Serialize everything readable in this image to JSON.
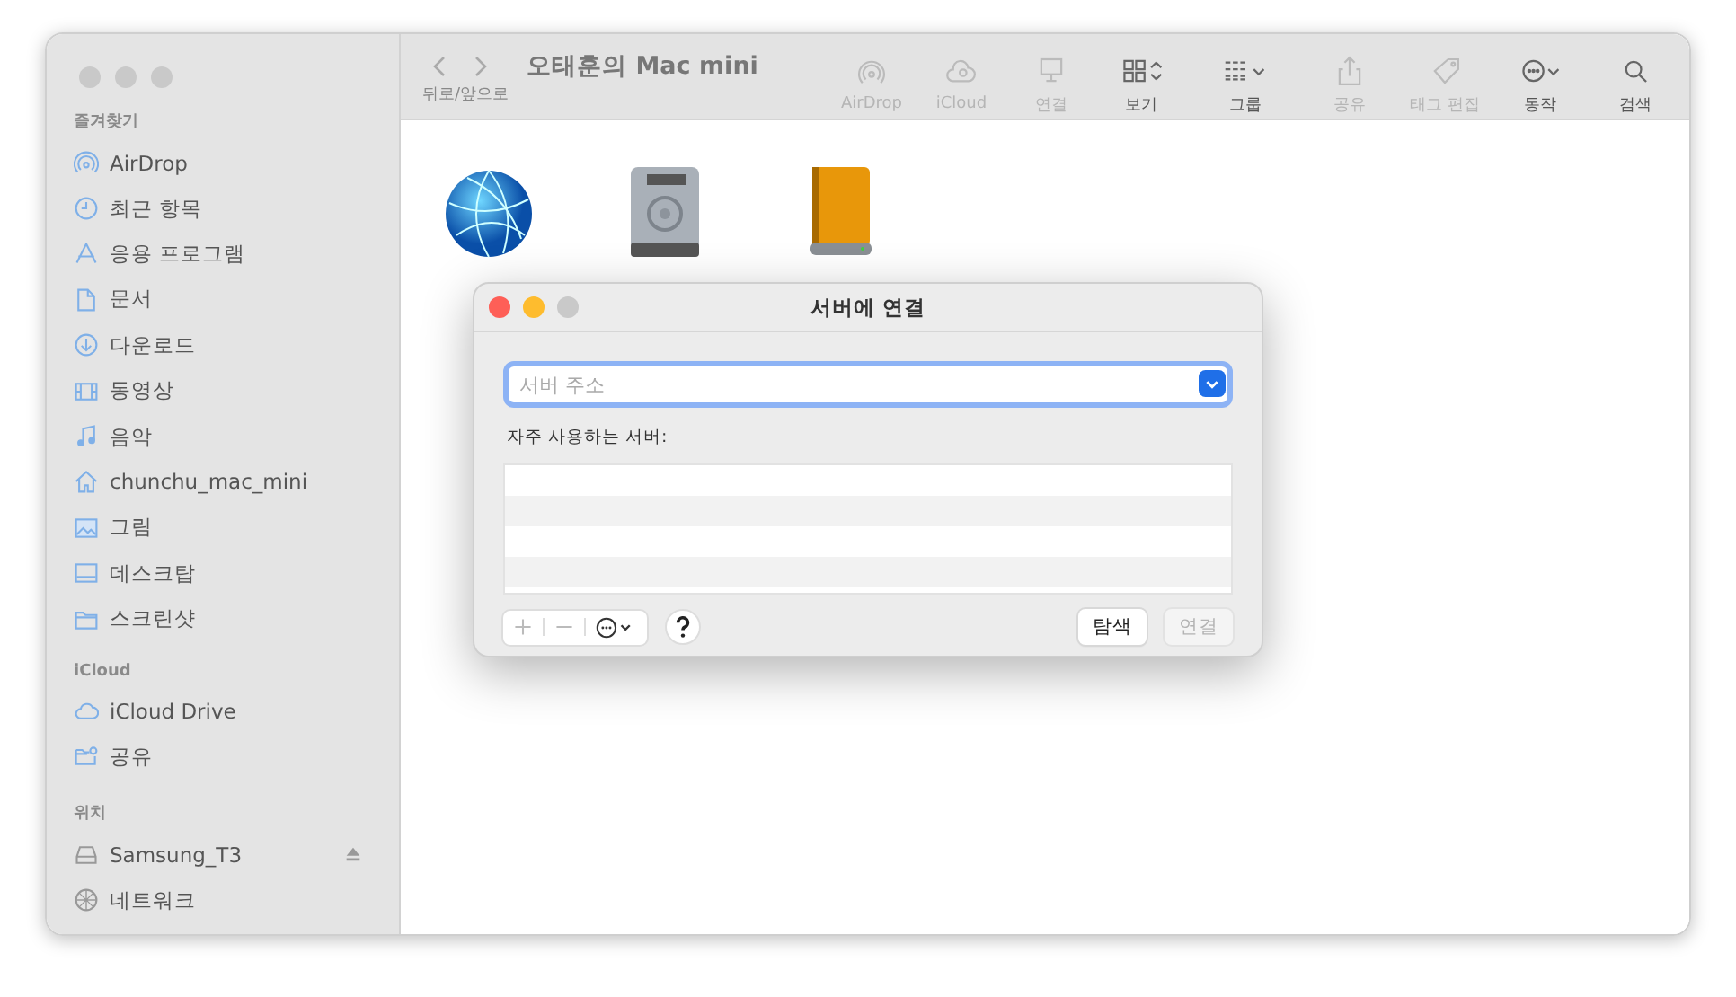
{
  "window": {
    "title": "오태훈의 Mac mini",
    "nav_label": "뒤로/앞으로"
  },
  "toolbar": [
    {
      "label": "AirDrop",
      "disabled": true
    },
    {
      "label": "iCloud",
      "disabled": true
    },
    {
      "label": "연결",
      "disabled": true
    },
    {
      "label": "보기",
      "disabled": false
    },
    {
      "label": "그룹",
      "disabled": false
    },
    {
      "label": "공유",
      "disabled": true
    },
    {
      "label": "태그 편집",
      "disabled": true
    },
    {
      "label": "동작",
      "disabled": false
    },
    {
      "label": "검색",
      "disabled": false
    }
  ],
  "sidebar": {
    "sections": [
      {
        "title": "즐겨찾기",
        "items": [
          {
            "label": "AirDrop"
          },
          {
            "label": "최근 항목"
          },
          {
            "label": "응용 프로그램"
          },
          {
            "label": "문서"
          },
          {
            "label": "다운로드"
          },
          {
            "label": "동영상"
          },
          {
            "label": "음악"
          },
          {
            "label": "chunchu_mac_mini"
          },
          {
            "label": "그림"
          },
          {
            "label": "데스크탑"
          },
          {
            "label": "스크린샷"
          }
        ]
      },
      {
        "title": "iCloud",
        "items": [
          {
            "label": "iCloud Drive"
          },
          {
            "label": "공유"
          }
        ]
      },
      {
        "title": "위치",
        "items": [
          {
            "label": "Samsung_T3",
            "eject": true
          },
          {
            "label": "네트워크",
            "eject": false
          }
        ]
      }
    ]
  },
  "files": [
    {
      "kind": "network"
    },
    {
      "kind": "disk"
    },
    {
      "kind": "external"
    }
  ],
  "dialog": {
    "title": "서버에 연결",
    "address": {
      "placeholder": "서버 주소"
    },
    "favorites_label": "자주 사용하는 서버:",
    "buttons": [
      {
        "label": "탐색",
        "disabled": false
      },
      {
        "label": "연결",
        "disabled": true
      }
    ]
  }
}
